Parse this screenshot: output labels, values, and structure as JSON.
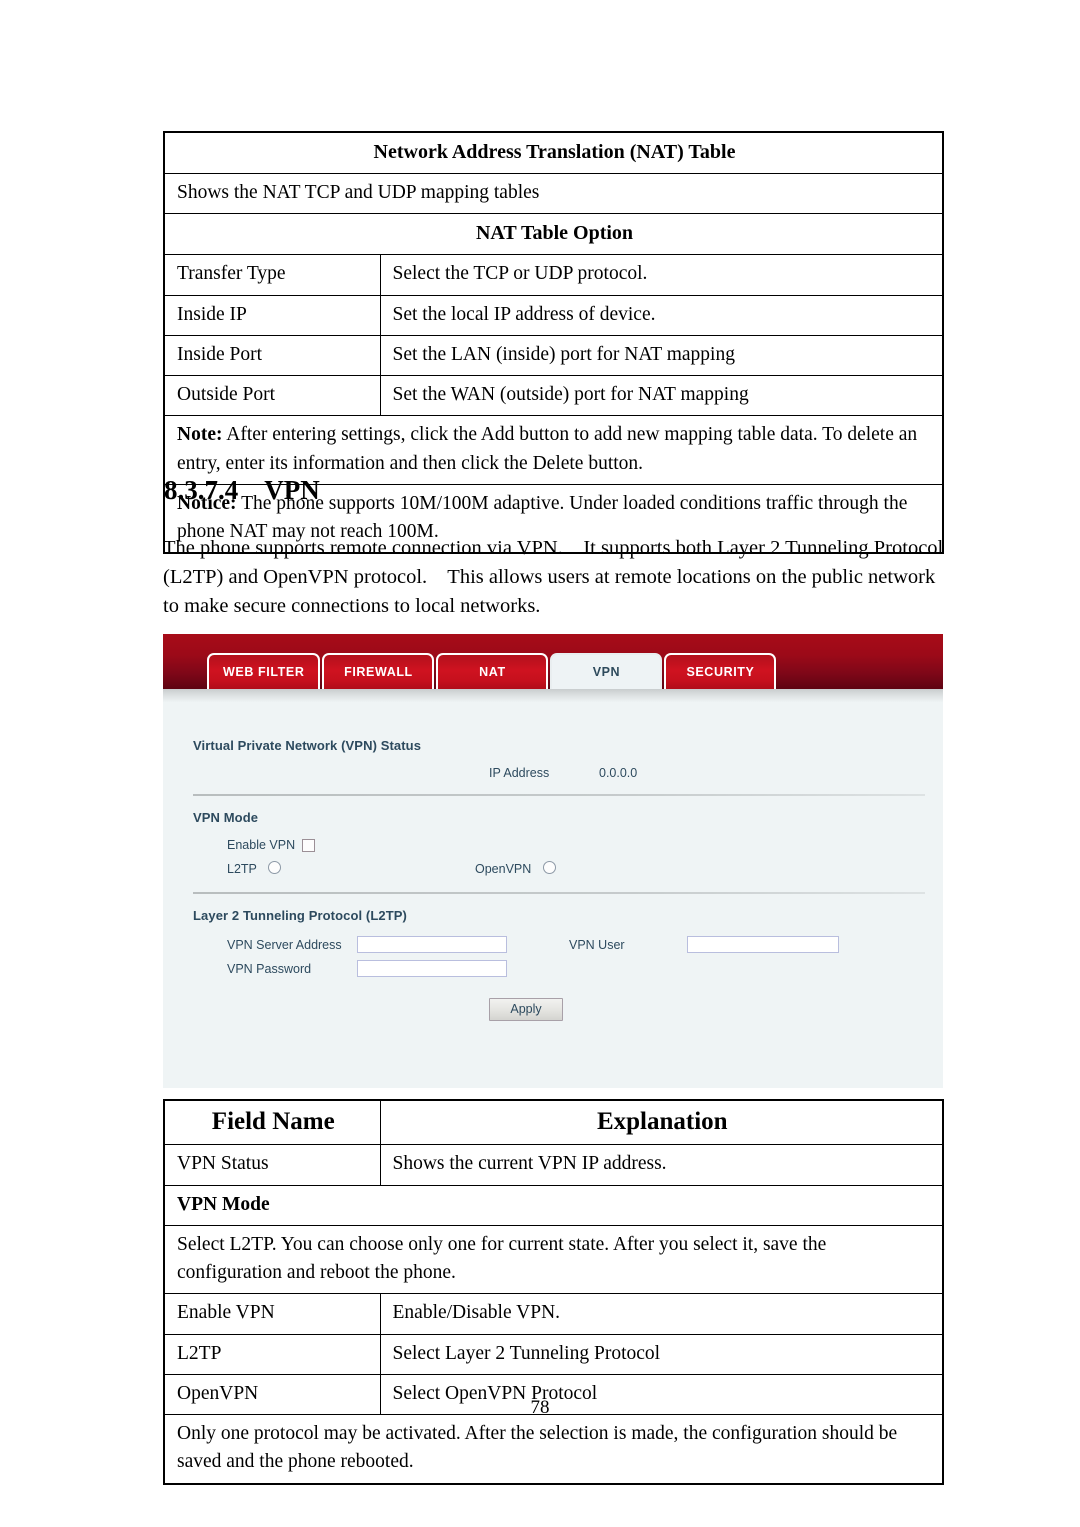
{
  "nat_table": {
    "title": "Network Address Translation (NAT) Table",
    "description": "Shows the NAT TCP and UDP mapping tables",
    "option_header": "NAT Table Option",
    "rows": [
      {
        "field": "Transfer Type",
        "explanation": "Select the TCP or UDP protocol."
      },
      {
        "field": "Inside IP",
        "explanation": "Set the local IP address of device."
      },
      {
        "field": "Inside Port",
        "explanation": "Set the LAN (inside) port for NAT mapping"
      },
      {
        "field": "Outside Port",
        "explanation": "Set the WAN (outside) port for NAT mapping"
      }
    ],
    "note_label": "Note:",
    "note_text": " After entering settings, click the Add button to add new mapping table data.    To delete an entry, enter its information and then click the Delete button.",
    "notice_label": "Notice:",
    "notice_text": " The phone supports 10M/100M adaptive. Under loaded conditions traffic through the phone NAT may not reach 100M."
  },
  "section": {
    "number": "8.3.7.4",
    "title": "VPN",
    "paragraph": "The phone supports remote connection via VPN.    It supports both Layer 2 Tunneling Protocol (L2TP) and OpenVPN protocol.    This allows users at remote locations on the public network to make secure connections to local networks."
  },
  "webui": {
    "tabs": [
      {
        "label": "WEB FILTER",
        "active": false
      },
      {
        "label": "FIREWALL",
        "active": false
      },
      {
        "label": "NAT",
        "active": false
      },
      {
        "label": "VPN",
        "active": true
      },
      {
        "label": "SECURITY",
        "active": false
      }
    ],
    "status_section": {
      "title": "Virtual Private Network (VPN) Status",
      "ip_address_label": "IP Address",
      "ip_address_value": "0.0.0.0"
    },
    "mode_section": {
      "title": "VPN Mode",
      "enable_vpn_label": "Enable VPN",
      "enable_vpn_checked": false,
      "l2tp_label": "L2TP",
      "l2tp_selected": false,
      "openvpn_label": "OpenVPN",
      "openvpn_selected": false
    },
    "l2tp_section": {
      "title": "Layer 2 Tunneling Protocol (L2TP)",
      "server_address_label": "VPN Server Address",
      "server_address_value": "",
      "vpn_user_label": "VPN User",
      "vpn_user_value": "",
      "vpn_password_label": "VPN Password",
      "vpn_password_value": "",
      "apply_label": "Apply"
    },
    "colors": {
      "header_red_top": "#a80c18",
      "header_red_bottom": "#5e0412",
      "tab_red": "#cf1220",
      "panel_bg": "#eff4f5",
      "label_text": "#2d4a5e"
    }
  },
  "field_table": {
    "col_field_header": "Field Name",
    "col_explanation_header": "Explanation",
    "rows": [
      {
        "field": "VPN Status",
        "explanation": "Shows the current VPN IP address."
      }
    ],
    "vpn_mode_header": "VPN Mode",
    "vpn_mode_note": "Select L2TP. You can choose only one for current state. After you select it, save the configuration and reboot the phone.",
    "mode_rows": [
      {
        "field": "Enable VPN",
        "explanation": "Enable/Disable VPN."
      },
      {
        "field": "L2TP",
        "explanation": "Select Layer 2 Tunneling Protocol"
      },
      {
        "field": "OpenVPN",
        "explanation": "Select OpenVPN Protocol"
      }
    ],
    "footer_note": "Only one protocol may be activated.    After the selection is made, the configuration should be saved and the phone rebooted."
  },
  "page_number": "78"
}
